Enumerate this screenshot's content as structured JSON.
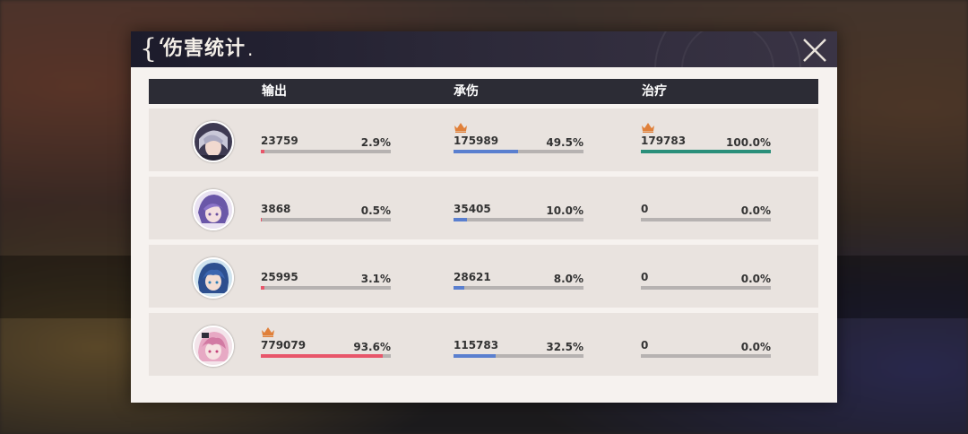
{
  "window": {
    "title": "伤害统计"
  },
  "columns": {
    "output": "输出",
    "tank": "承伤",
    "heal": "治疗"
  },
  "colors": {
    "output_bar": "#e8566a",
    "tank_bar": "#5a7fcf",
    "heal_bar": "#2a8f7a",
    "crown": "#e0803a"
  },
  "rows": [
    {
      "avatar": "character-1-avatar",
      "output": {
        "value": "23759",
        "pct": "2.9%",
        "fraction": 0.029,
        "crown": false
      },
      "tank": {
        "value": "175989",
        "pct": "49.5%",
        "fraction": 0.495,
        "crown": true
      },
      "heal": {
        "value": "179783",
        "pct": "100.0%",
        "fraction": 1.0,
        "crown": true
      }
    },
    {
      "avatar": "character-2-avatar",
      "output": {
        "value": "3868",
        "pct": "0.5%",
        "fraction": 0.005,
        "crown": false
      },
      "tank": {
        "value": "35405",
        "pct": "10.0%",
        "fraction": 0.1,
        "crown": false
      },
      "heal": {
        "value": "0",
        "pct": "0.0%",
        "fraction": 0.0,
        "crown": false
      }
    },
    {
      "avatar": "character-3-avatar",
      "output": {
        "value": "25995",
        "pct": "3.1%",
        "fraction": 0.031,
        "crown": false
      },
      "tank": {
        "value": "28621",
        "pct": "8.0%",
        "fraction": 0.08,
        "crown": false
      },
      "heal": {
        "value": "0",
        "pct": "0.0%",
        "fraction": 0.0,
        "crown": false
      }
    },
    {
      "avatar": "character-4-avatar",
      "output": {
        "value": "779079",
        "pct": "93.6%",
        "fraction": 0.936,
        "crown": true
      },
      "tank": {
        "value": "115783",
        "pct": "32.5%",
        "fraction": 0.325,
        "crown": false
      },
      "heal": {
        "value": "0",
        "pct": "0.0%",
        "fraction": 0.0,
        "crown": false
      }
    }
  ]
}
